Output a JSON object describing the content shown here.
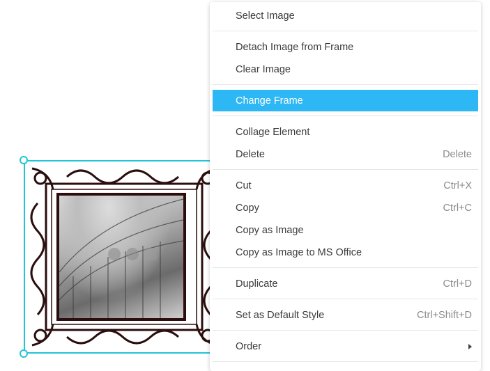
{
  "colors": {
    "selection": "#22c4d8",
    "highlight": "#2db7f5",
    "frame": "#2b0e0e",
    "shortcut_text": "#8b8b8b"
  },
  "canvas": {
    "element": {
      "type": "framed-image",
      "frame_style": "ornate-scroll",
      "image_subject": "photo"
    }
  },
  "context_menu": {
    "items": [
      {
        "label": "Select Image",
        "shortcut": ""
      },
      {
        "label": "Detach Image from Frame",
        "shortcut": ""
      },
      {
        "label": "Clear Image",
        "shortcut": ""
      },
      {
        "label": "Change Frame",
        "shortcut": "",
        "highlighted": true
      },
      {
        "label": "Collage Element",
        "shortcut": ""
      },
      {
        "label": "Delete",
        "shortcut": "Delete"
      },
      {
        "label": "Cut",
        "shortcut": "Ctrl+X"
      },
      {
        "label": "Copy",
        "shortcut": "Ctrl+C"
      },
      {
        "label": "Copy as Image",
        "shortcut": ""
      },
      {
        "label": "Copy as Image to MS Office",
        "shortcut": ""
      },
      {
        "label": "Duplicate",
        "shortcut": "Ctrl+D"
      },
      {
        "label": "Set as Default Style",
        "shortcut": "Ctrl+Shift+D"
      },
      {
        "label": "Order",
        "shortcut": "",
        "submenu_icon": "chevron-right-icon"
      }
    ]
  }
}
